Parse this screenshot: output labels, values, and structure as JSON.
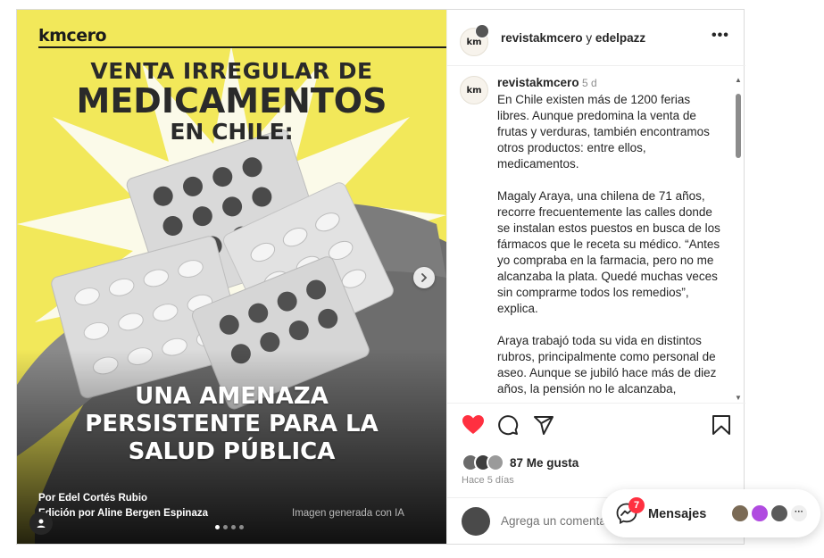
{
  "post_image": {
    "brand": "kmcero",
    "headline_line1": "VENTA IRREGULAR DE",
    "headline_line2": "MEDICAMENTOS",
    "headline_line3": "EN CHILE:",
    "subheadline_line1": "UNA AMENAZA",
    "subheadline_line2": "PERSISTENTE PARA LA",
    "subheadline_line3": "SALUD PÚBLICA",
    "credit_author": "Por Edel Cortés Rubio",
    "credit_editor": "Edición por Aline Bergen Espinaza",
    "credit_ai": "Imagen generada con IA",
    "carousel_dots": 4,
    "carousel_active_index": 0,
    "colors": {
      "background": "#f2e85a",
      "headline": "#2a2a2a"
    }
  },
  "header": {
    "author": "revistakmcero",
    "separator": "y",
    "collaborator": "edelpazz",
    "avatar_text": "km",
    "more_icon": "more-horizontal-icon"
  },
  "caption": {
    "username": "revistakmcero",
    "time": "5 d",
    "paragraphs": [
      "En Chile existen más de 1200 ferias libres. Aunque predomina la venta de frutas y verduras, también encontramos otros productos: entre ellos, medicamentos.",
      "Magaly Araya, una chilena de 71 años, recorre frecuentemente las calles donde se instalan estos puestos en busca de los fármacos que le receta su médico. “Antes yo compraba en la farmacia, pero no me alcanzaba la plata. Quedé muchas veces sin comprarme todos los remedios”, explica.",
      "Araya trabajó toda su vida en distintos rubros, principalmente como personal de aseo. Aunque se jubiló hace más de diez años, la pensión no le alcanzaba,"
    ]
  },
  "actions": {
    "like_icon": "heart-filled-icon",
    "comment_icon": "comment-icon",
    "share_icon": "share-icon",
    "save_icon": "bookmark-icon",
    "like_color": "#ff3040",
    "likes_text": "87 Me gusta",
    "time_ago": "Hace 5 días"
  },
  "comment": {
    "placeholder": "Agrega un comentario..."
  },
  "messages": {
    "label": "Mensajes",
    "badge": "7",
    "more": "···"
  }
}
